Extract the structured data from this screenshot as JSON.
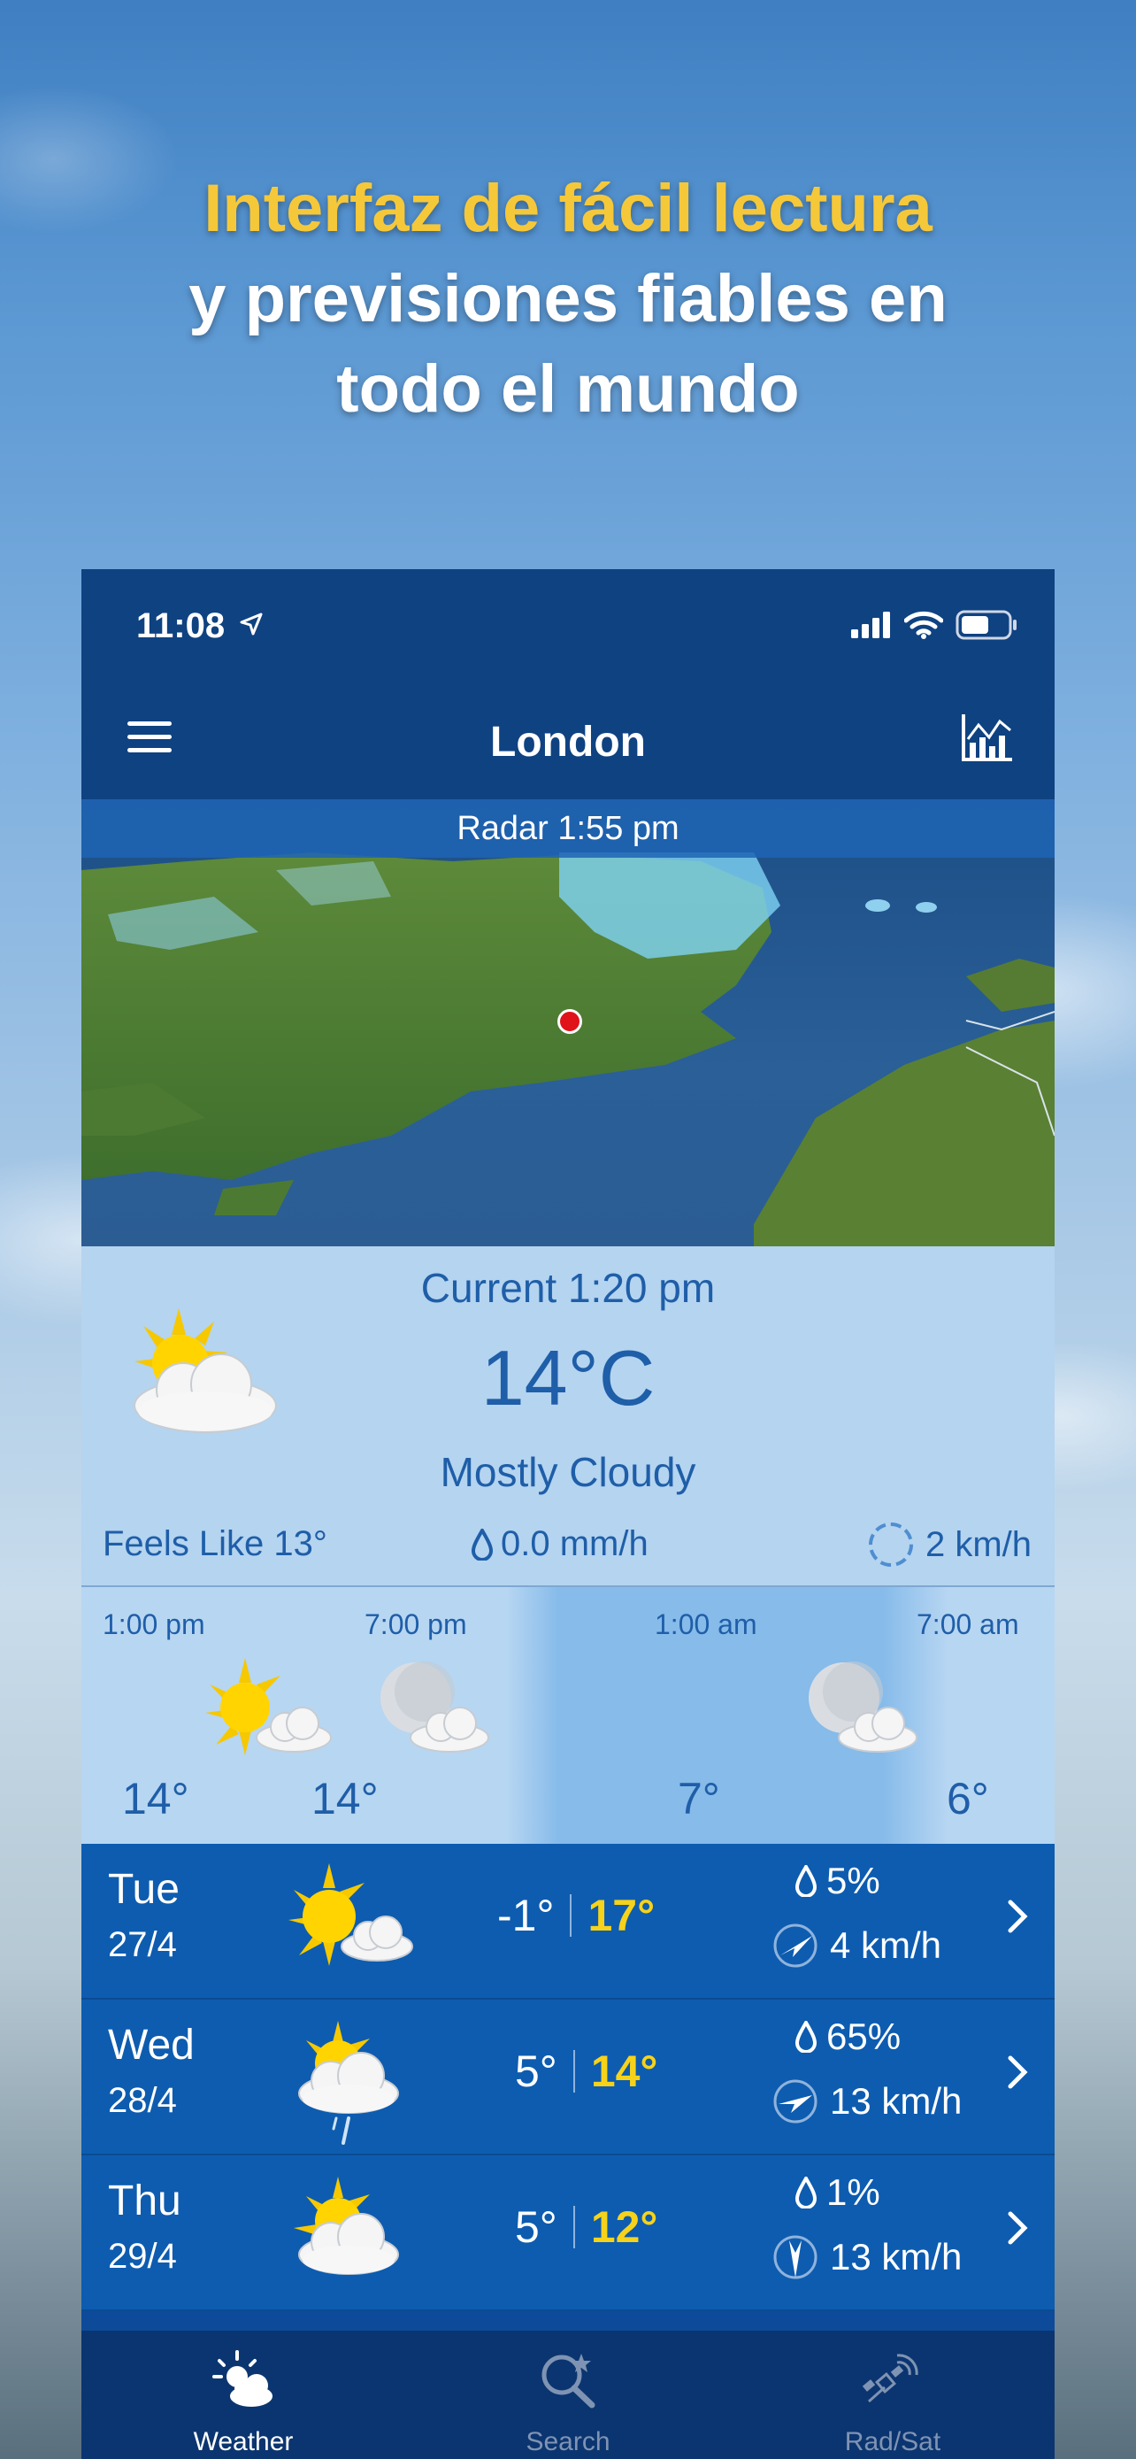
{
  "promo": {
    "line1": "Interfaz de fácil lectura",
    "line2": "y previsiones fiables en",
    "line3": "todo el mundo"
  },
  "status_bar": {
    "time": "11:08"
  },
  "nav": {
    "title": "London"
  },
  "radar": {
    "label": "Radar  1:55 pm"
  },
  "current": {
    "title": "Current  1:20 pm",
    "temperature": "14°C",
    "condition": "Mostly Cloudy",
    "feels_like": "Feels Like 13°",
    "precipitation": "0.0 mm/h",
    "wind": "2 km/h",
    "icon": "sun-behind-cloud-icon"
  },
  "hourly": [
    {
      "time": "1:00 pm",
      "temp": "14°",
      "icon": "sun-cloud-icon"
    },
    {
      "time": "7:00 pm",
      "temp": "14°",
      "icon": "moon-cloud-icon"
    },
    {
      "time": "1:00 am",
      "temp": "7°",
      "icon": "moon-cloud-icon"
    },
    {
      "time": "7:00 am",
      "temp": "6°",
      "icon": "moon-cloud-icon"
    }
  ],
  "daily": [
    {
      "day": "Tue",
      "date": "27/4",
      "low": "-1°",
      "high": "17°",
      "precip": "5%",
      "wind": "4 km/h",
      "icon": "sun-cloud-icon"
    },
    {
      "day": "Wed",
      "date": "28/4",
      "low": "5°",
      "high": "14°",
      "precip": "65%",
      "wind": "13 km/h",
      "icon": "sun-cloud-rain-icon"
    },
    {
      "day": "Thu",
      "date": "29/4",
      "low": "5°",
      "high": "12°",
      "precip": "1%",
      "wind": "13 km/h",
      "icon": "sun-behind-cloud-icon"
    }
  ],
  "tabs": [
    {
      "label": "Weather",
      "active": true
    },
    {
      "label": "Search",
      "active": false
    },
    {
      "label": "Rad/Sat",
      "active": false
    }
  ],
  "colors": {
    "accent_yellow": "#f6d21a",
    "headline_yellow": "#f5c83a",
    "nav_blue": "#0f4281",
    "row_blue": "#0d5cb0",
    "panel_light": "#b4d4f0"
  }
}
